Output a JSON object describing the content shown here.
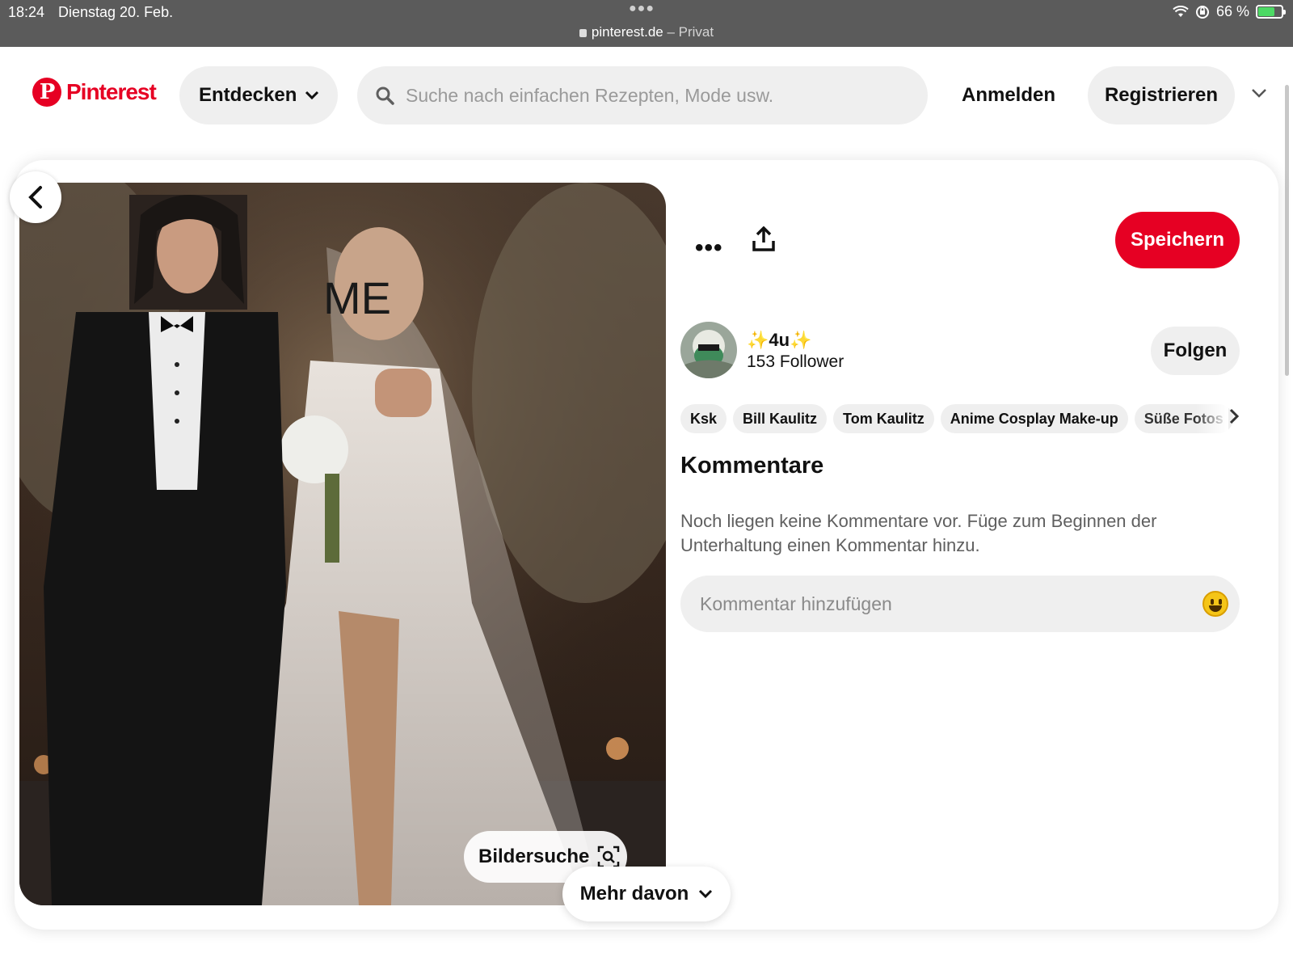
{
  "status_bar": {
    "time": "18:24",
    "date": "Dienstag 20. Feb.",
    "domain": "pinterest.de",
    "mode": " – Privat",
    "battery": "66 %",
    "battery_level": 0.66,
    "battery_color": "#4cd964"
  },
  "header": {
    "logo_text": "Pinterest",
    "brand_color": "#e60023",
    "explore_label": "Entdecken",
    "search_placeholder": "Suche nach einfachen Rezepten, Mode usw.",
    "login_label": "Anmelden",
    "register_label": "Registrieren"
  },
  "pin": {
    "image_overlay_text": "ME",
    "lens_label": "Bildersuche",
    "more_label": "Mehr davon",
    "save_label": "Speichern",
    "author": {
      "name": "✨4u✨",
      "followers": "153 Follower",
      "follow_label": "Folgen"
    },
    "tags": [
      "Ksk",
      "Bill Kaulitz",
      "Tom Kaulitz",
      "Anime Cosplay Make-up",
      "Süße Fotos"
    ],
    "comments": {
      "title": "Kommentare",
      "empty_text": "Noch liegen keine Kommentare vor. Füge zum Beginnen der Unterhaltung einen Kommentar hinzu.",
      "input_placeholder": "Kommentar hinzufügen"
    }
  },
  "icons": [
    "wifi-icon",
    "orientation-lock-icon",
    "battery-icon",
    "search-icon",
    "chevron-down-icon",
    "back-arrow-icon",
    "more-icon",
    "share-icon",
    "visual-search-icon",
    "chevron-right-icon",
    "emoji-icon"
  ]
}
